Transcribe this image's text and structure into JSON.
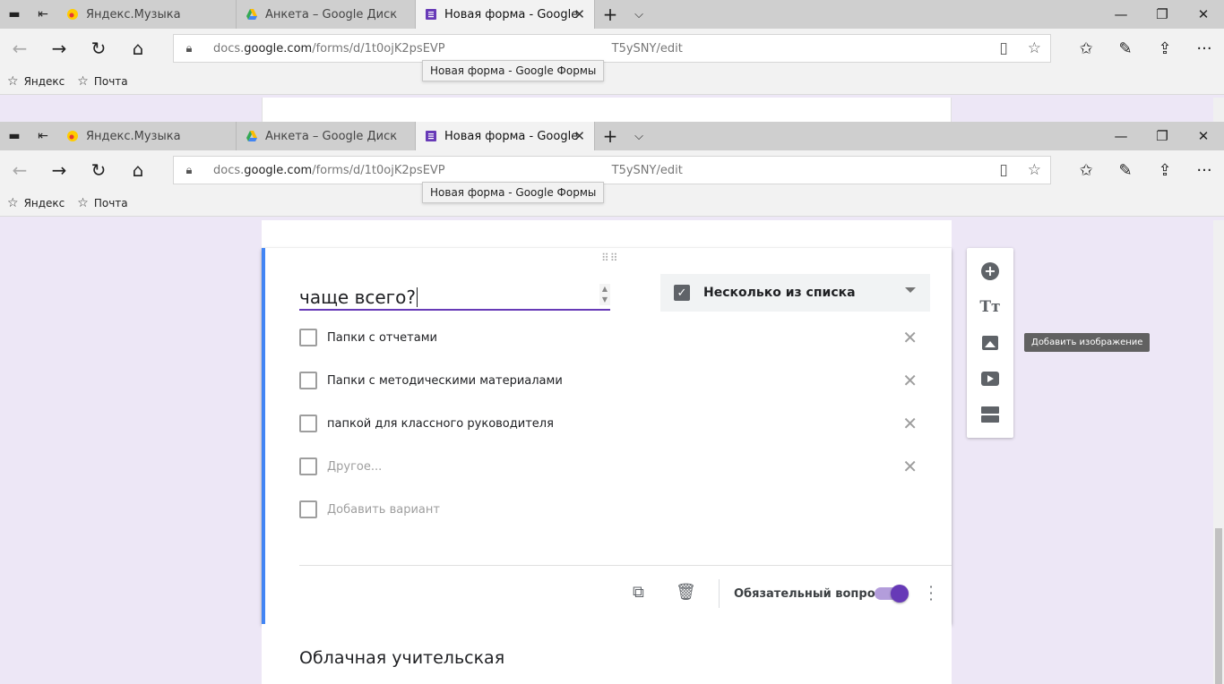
{
  "browser": {
    "tabs": [
      {
        "label": "Яндекс.Музыка",
        "icon": "yandex-music-icon",
        "active": false
      },
      {
        "label": "Анкета  – Google Диск",
        "icon": "google-drive-icon",
        "active": false
      },
      {
        "label": "Новая форма - Google",
        "icon": "google-forms-icon",
        "active": true
      }
    ],
    "tab_tooltip": "Новая форма - Google Формы",
    "url_prefix": "docs.",
    "url_domain": "google.com",
    "url_path_start": "/forms/d/1t0ojK2psEVP",
    "url_path_end": "T5ySNY/edit",
    "favorites": [
      {
        "label": "Яндекс"
      },
      {
        "label": "Почта"
      }
    ]
  },
  "question": {
    "title": "чаще всего?",
    "type_label": "Несколько из списка",
    "options": [
      {
        "label": "Папки с отчетами"
      },
      {
        "label": "Папки с методическими материалами"
      },
      {
        "label": "папкой для классного руководителя"
      }
    ],
    "other_label": "Другое...",
    "add_option_label": "Добавить вариант",
    "required_label": "Обязательный вопрос",
    "required": true
  },
  "next_section": {
    "title": "Облачная учительская"
  },
  "side_toolbar": {
    "tooltip": "Добавить изображение"
  },
  "colors": {
    "accent": "#673ab7",
    "active_card_border": "#4285f4",
    "page_bg": "#ede7f6"
  }
}
